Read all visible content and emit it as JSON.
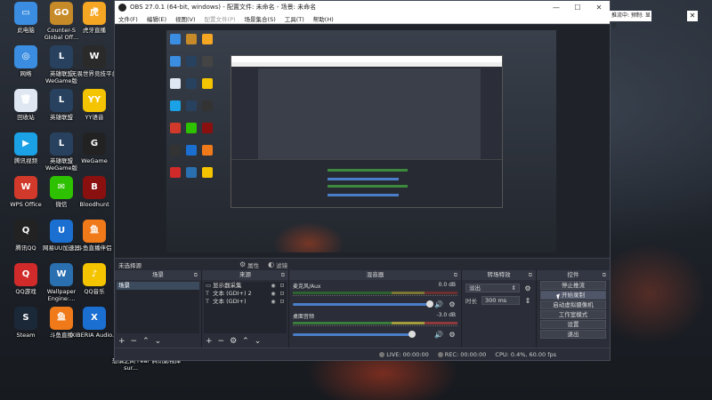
{
  "desktop": {
    "icons": [
      {
        "label": "此电脑",
        "color": "#3a8de0",
        "glyph": "▭"
      },
      {
        "label": "Counter-S Global Off...",
        "color": "#c68a28",
        "glyph": "GO"
      },
      {
        "label": "虎牙直播",
        "color": "#f5a623",
        "glyph": "虎"
      },
      {
        "label": "网络",
        "color": "#3a8de0",
        "glyph": "◎"
      },
      {
        "label": "英雄联盟 WeGame版",
        "color": "#27415f",
        "glyph": "L"
      },
      {
        "label": "无畏世界竞技平台",
        "color": "#2a2a2a",
        "glyph": "W"
      },
      {
        "label": "回收站",
        "color": "#dfe7f2",
        "glyph": "🗑"
      },
      {
        "label": "英雄联盟",
        "color": "#27415f",
        "glyph": "L"
      },
      {
        "label": "YY语音",
        "color": "#f5c400",
        "glyph": "YY"
      },
      {
        "label": "腾讯视频",
        "color": "#1aa1e6",
        "glyph": "▶"
      },
      {
        "label": "英雄联盟 WeGame版",
        "color": "#27415f",
        "glyph": "L"
      },
      {
        "label": "WeGame",
        "color": "#222",
        "glyph": "G"
      },
      {
        "label": "WPS Office",
        "color": "#d13a2a",
        "glyph": "W"
      },
      {
        "label": "微信",
        "color": "#2dc100",
        "glyph": "✉"
      },
      {
        "label": "Bloodhunt",
        "color": "#8a1010",
        "glyph": "B"
      },
      {
        "label": "腾讯QQ",
        "color": "#222",
        "glyph": "Q"
      },
      {
        "label": "网易UU加速器",
        "color": "#1a6fd1",
        "glyph": "U"
      },
      {
        "label": "斗鱼直播伴侣",
        "color": "#f07a1a",
        "glyph": "鱼"
      },
      {
        "label": "QQ游戏",
        "color": "#d12a2a",
        "glyph": "Q"
      },
      {
        "label": "Wallpaper Engine:...",
        "color": "#2a6fb0",
        "glyph": "W"
      },
      {
        "label": "QQ音乐",
        "color": "#f5c400",
        "glyph": "♪"
      },
      {
        "label": "Steam",
        "color": "#1b2838",
        "glyph": "S"
      },
      {
        "label": "斗鱼直播",
        "color": "#f07a1a",
        "glyph": "鱼"
      },
      {
        "label": "XIBERIA Audio...",
        "color": "#1a6fd1",
        "glyph": "X"
      }
    ],
    "bottom_labels": [
      "恐惧之间 Fear sur...",
      "腾讯影视库"
    ]
  },
  "obs": {
    "title": "OBS 27.0.1 (64-bit, windows) - 配置文件: 未命名 - 场景: 未命名",
    "menu": [
      "文件(F)",
      "编辑(E)",
      "视图(V)",
      "配置文件(P)",
      "场景集合(S)",
      "工具(T)",
      "帮助(H)"
    ],
    "no_source": "未选择源",
    "tools": [
      "属性",
      "滤镜"
    ],
    "docks": {
      "scenes": {
        "title": "场景",
        "items": [
          "场景"
        ]
      },
      "sources": {
        "title": "来源",
        "items": [
          {
            "icon": "▭",
            "name": "显示器采集"
          },
          {
            "icon": "T",
            "name": "文本 (GDI+) 2"
          },
          {
            "icon": "T",
            "name": "文本 (GDI+)"
          }
        ]
      },
      "mixer": {
        "title": "混音器",
        "tracks": [
          {
            "name": "麦克风/Aux",
            "db": "0.0 dB"
          },
          {
            "name": "桌面音频",
            "db": "-3.0 dB"
          }
        ]
      },
      "transitions": {
        "title": "转场特效",
        "type": "淡出",
        "duration_label": "时长",
        "duration": "300 ms"
      },
      "controls": {
        "title": "控件",
        "buttons": [
          "停止推流",
          "开始录制",
          "启动虚拟摄像机",
          "工作室模式",
          "设置",
          "退出"
        ]
      }
    },
    "status": {
      "live": "LIVE: 00:00:00",
      "rec": "REC: 00:00:00",
      "cpu": "CPU: 0.4%, 60.00 fps"
    }
  },
  "recbar": {
    "text": "推流中: 预制: 显示"
  }
}
